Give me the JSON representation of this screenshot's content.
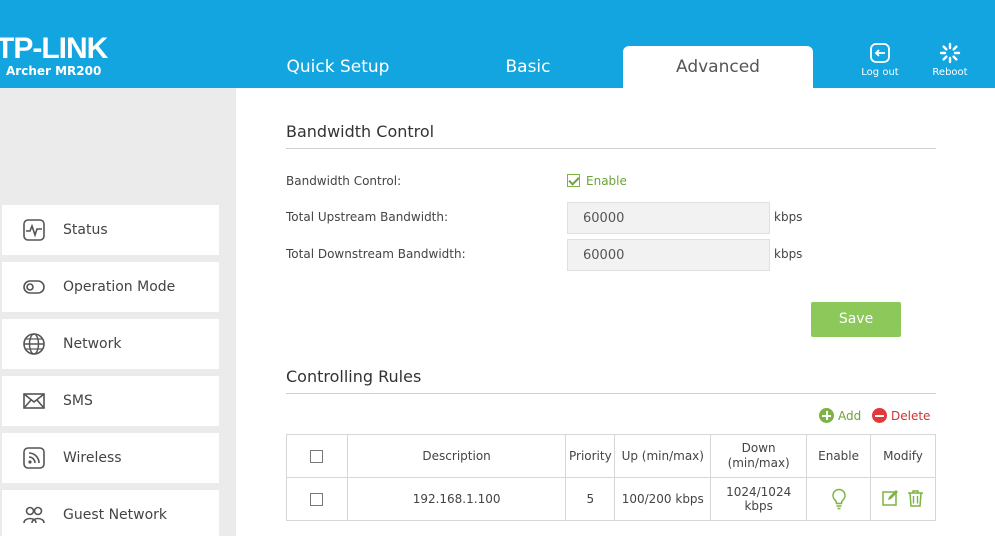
{
  "header": {
    "brand": "TP-LINK",
    "model": "Archer MR200",
    "tabs": [
      {
        "label": "Quick Setup"
      },
      {
        "label": "Basic"
      },
      {
        "label": "Advanced"
      }
    ],
    "logout_label": "Log out",
    "reboot_label": "Reboot"
  },
  "sidebar": {
    "items": [
      {
        "label": "Status",
        "icon": "status-icon"
      },
      {
        "label": "Operation Mode",
        "icon": "operation-mode-icon"
      },
      {
        "label": "Network",
        "icon": "globe-icon"
      },
      {
        "label": "SMS",
        "icon": "envelope-icon"
      },
      {
        "label": "Wireless",
        "icon": "wireless-icon"
      },
      {
        "label": "Guest Network",
        "icon": "guest-network-icon"
      }
    ]
  },
  "bandwidth": {
    "title": "Bandwidth Control",
    "control_label": "Bandwidth Control:",
    "enable_label": "Enable",
    "enabled": true,
    "upstream_label": "Total Upstream Bandwidth:",
    "upstream_value": "60000",
    "downstream_label": "Total Downstream Bandwidth:",
    "downstream_value": "60000",
    "unit": "kbps",
    "save_label": "Save"
  },
  "rules": {
    "title": "Controlling Rules",
    "add_label": "Add",
    "delete_label": "Delete",
    "columns": [
      "Description",
      "Priority",
      "Up (min/max)",
      "Down\n(min/max)",
      "Enable",
      "Modify"
    ],
    "rows": [
      {
        "description": "192.168.1.100",
        "priority": "5",
        "up": "100/200 kbps",
        "down": "1024/1024 kbps"
      }
    ]
  },
  "colors": {
    "header": "#13a5df",
    "accent_green": "#8dc85a",
    "delete_red": "#e03a3a"
  }
}
